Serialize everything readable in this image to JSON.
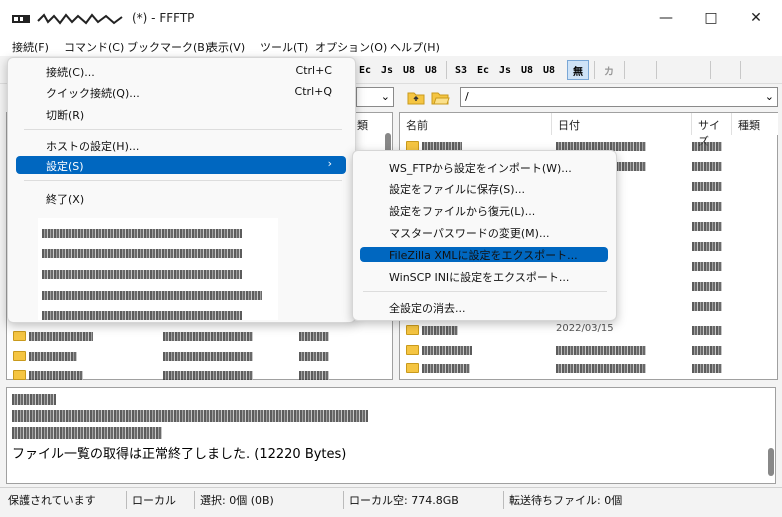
{
  "window": {
    "title": "(*) - FFFTP",
    "minimize": "—",
    "maximize": "□",
    "close": "✕"
  },
  "menubar": [
    {
      "label": "接続(F)"
    },
    {
      "label": "コマンド(C)"
    },
    {
      "label": "ブックマーク(B)"
    },
    {
      "label": "表示(V)"
    },
    {
      "label": "ツール(T)"
    },
    {
      "label": "オプション(O)"
    },
    {
      "label": "ヘルプ(H)"
    }
  ],
  "toolbar": {
    "buttons": [
      "Ec",
      "Js",
      "U8",
      "U8",
      "S3",
      "Ec",
      "Js",
      "U8",
      "U8",
      "無",
      "カ"
    ]
  },
  "left_pane": {
    "headers": {
      "type": "類"
    },
    "rows_visible": 3
  },
  "right_pane": {
    "path": "/",
    "headers": {
      "name": "名前",
      "date": "日付",
      "size": "サイズ",
      "type": "種類"
    },
    "date_fragment": "2022/03/15"
  },
  "file_menu": {
    "items": [
      {
        "label": "接続(C)...",
        "shortcut": "Ctrl+C"
      },
      {
        "label": "クイック接続(Q)...",
        "shortcut": "Ctrl+Q"
      },
      {
        "label": "切断(R)",
        "shortcut": ""
      },
      {
        "label": "ホストの設定(H)...",
        "shortcut": ""
      },
      {
        "label": "設定(S)",
        "shortcut": "›"
      },
      {
        "label": "終了(X)",
        "shortcut": ""
      }
    ]
  },
  "settings_submenu": {
    "items": [
      {
        "label": "WS_FTPから設定をインポート(W)..."
      },
      {
        "label": "設定をファイルに保存(S)..."
      },
      {
        "label": "設定をファイルから復元(L)..."
      },
      {
        "label": "マスターパスワードの変更(M)..."
      },
      {
        "label": "FileZilla XMLに設定をエクスポート..."
      },
      {
        "label": "WinSCP INIに設定をエクスポート..."
      },
      {
        "label": "全設定の消去..."
      }
    ]
  },
  "log": {
    "last_line": "ファイル一覧の取得は正常終了しました. (12220 Bytes)"
  },
  "status": {
    "protection": "保護されています",
    "mode": "ローカル",
    "selected": "選択: 0個 (0B)",
    "local_free": "ローカル空: 774.8GB",
    "queue": "転送待ちファイル: 0個"
  },
  "colors": {
    "accent": "#0067c0",
    "folder": "#f5c542"
  }
}
